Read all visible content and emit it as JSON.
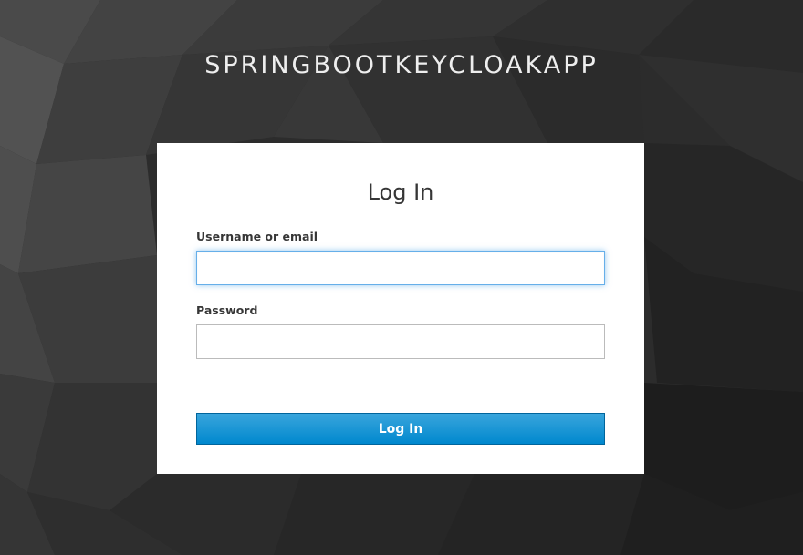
{
  "realm": {
    "title": "SPRINGBOOTKEYCLOAKAPP"
  },
  "login_form": {
    "title": "Log In",
    "username_label": "Username or email",
    "username_value": "",
    "password_label": "Password",
    "password_value": "",
    "submit_label": "Log In"
  },
  "colors": {
    "background": "#2a2a2a",
    "card": "#ffffff",
    "button": "#0088ce",
    "focus_border": "#66afe9"
  }
}
